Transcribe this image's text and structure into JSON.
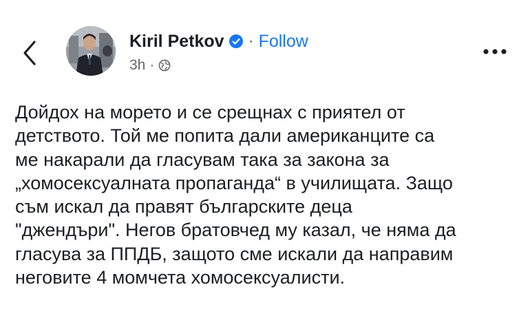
{
  "header": {
    "back_icon": "chevron-left-icon",
    "author_name": "Kiril Petkov",
    "verified_icon": "verified-badge-icon",
    "separator": "·",
    "follow_label": "Follow",
    "timestamp": "3h",
    "meta_separator": "·",
    "audience_icon": "globe-icon",
    "more_icon": "more-horizontal-icon"
  },
  "post": {
    "lines": [
      "Дойдох на морето и се срещнах с приятел от",
      "детството. Той ме попита дали американците са",
      "ме накарали да гласувам така за закона за",
      "„хомосексуалната пропаганда“ в училищата. Защо",
      "съм искал да правят българските деца",
      "\"джендъри\". Негов братовчед му казал, че няма да",
      "гласува за ППДБ, защото сме искали да направим",
      "неговите 4 момчета хомосексуалисти."
    ]
  },
  "colors": {
    "link": "#1877f2",
    "verified": "#1877f2",
    "text": "#1c1e21",
    "secondary_text": "#65676b"
  }
}
